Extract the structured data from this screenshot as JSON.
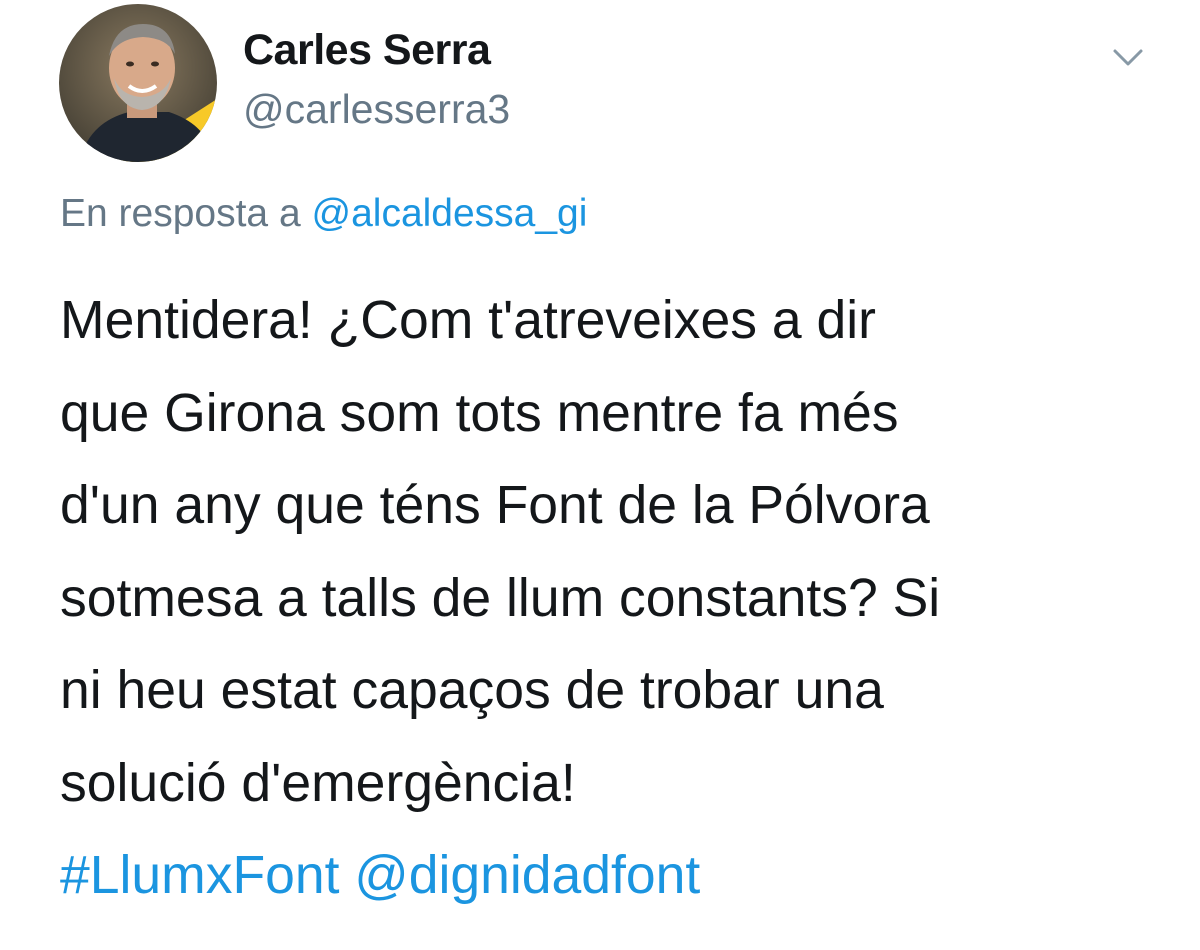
{
  "author": {
    "display_name": "Carles Serra",
    "handle": "@carlesserra3",
    "avatar_icon": "profile-photo"
  },
  "menu": {
    "icon": "chevron-down-icon"
  },
  "reply": {
    "prefix": "En resposta a",
    "mention": "@alcaldessa_gi"
  },
  "tweet": {
    "lines": [
      "Mentidera! ¿Com t'atreveixes a dir",
      "que Girona som tots mentre fa més",
      "d'un any que téns Font de la Pólvora",
      "sotmesa a talls de llum constants? Si",
      "ni heu estat capaços de trobar una",
      "solució d'emergència!"
    ],
    "hashtag": "#LlumxFont",
    "mention": "@dignidadfont"
  },
  "colors": {
    "text": "#14171a",
    "secondary": "#657786",
    "link": "#1b95e0",
    "avatar_accent": "#f7c928"
  }
}
